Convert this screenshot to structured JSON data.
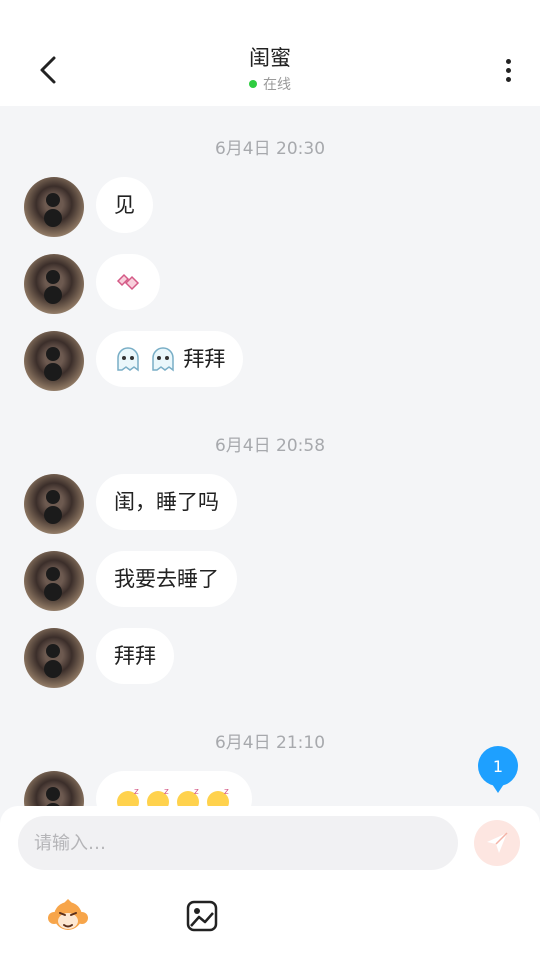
{
  "header": {
    "title": "闺蜜",
    "status": "在线",
    "status_color": "#2ecc40"
  },
  "messages": [
    {
      "time": "6月4日 20:30"
    },
    {
      "text": "见"
    },
    {
      "emoji": "waving-hands",
      "text": ""
    },
    {
      "emoji": "ghost-ghost",
      "text": "拜拜"
    },
    {
      "time": "6月4日 20:58"
    },
    {
      "text": "闺，睡了吗"
    },
    {
      "text": "我要去睡了"
    },
    {
      "text": "拜拜"
    },
    {
      "time": "6月4日 21:10"
    },
    {
      "emoji": "sleeping-faces-x4",
      "text": ""
    }
  ],
  "unread_badge": "1",
  "composer": {
    "placeholder": "请输入…"
  },
  "icons": {
    "back": "chevron-left-icon",
    "more": "more-vertical-icon",
    "send": "paper-plane-icon",
    "sticker": "monkey-sticker-icon",
    "image": "image-icon"
  }
}
